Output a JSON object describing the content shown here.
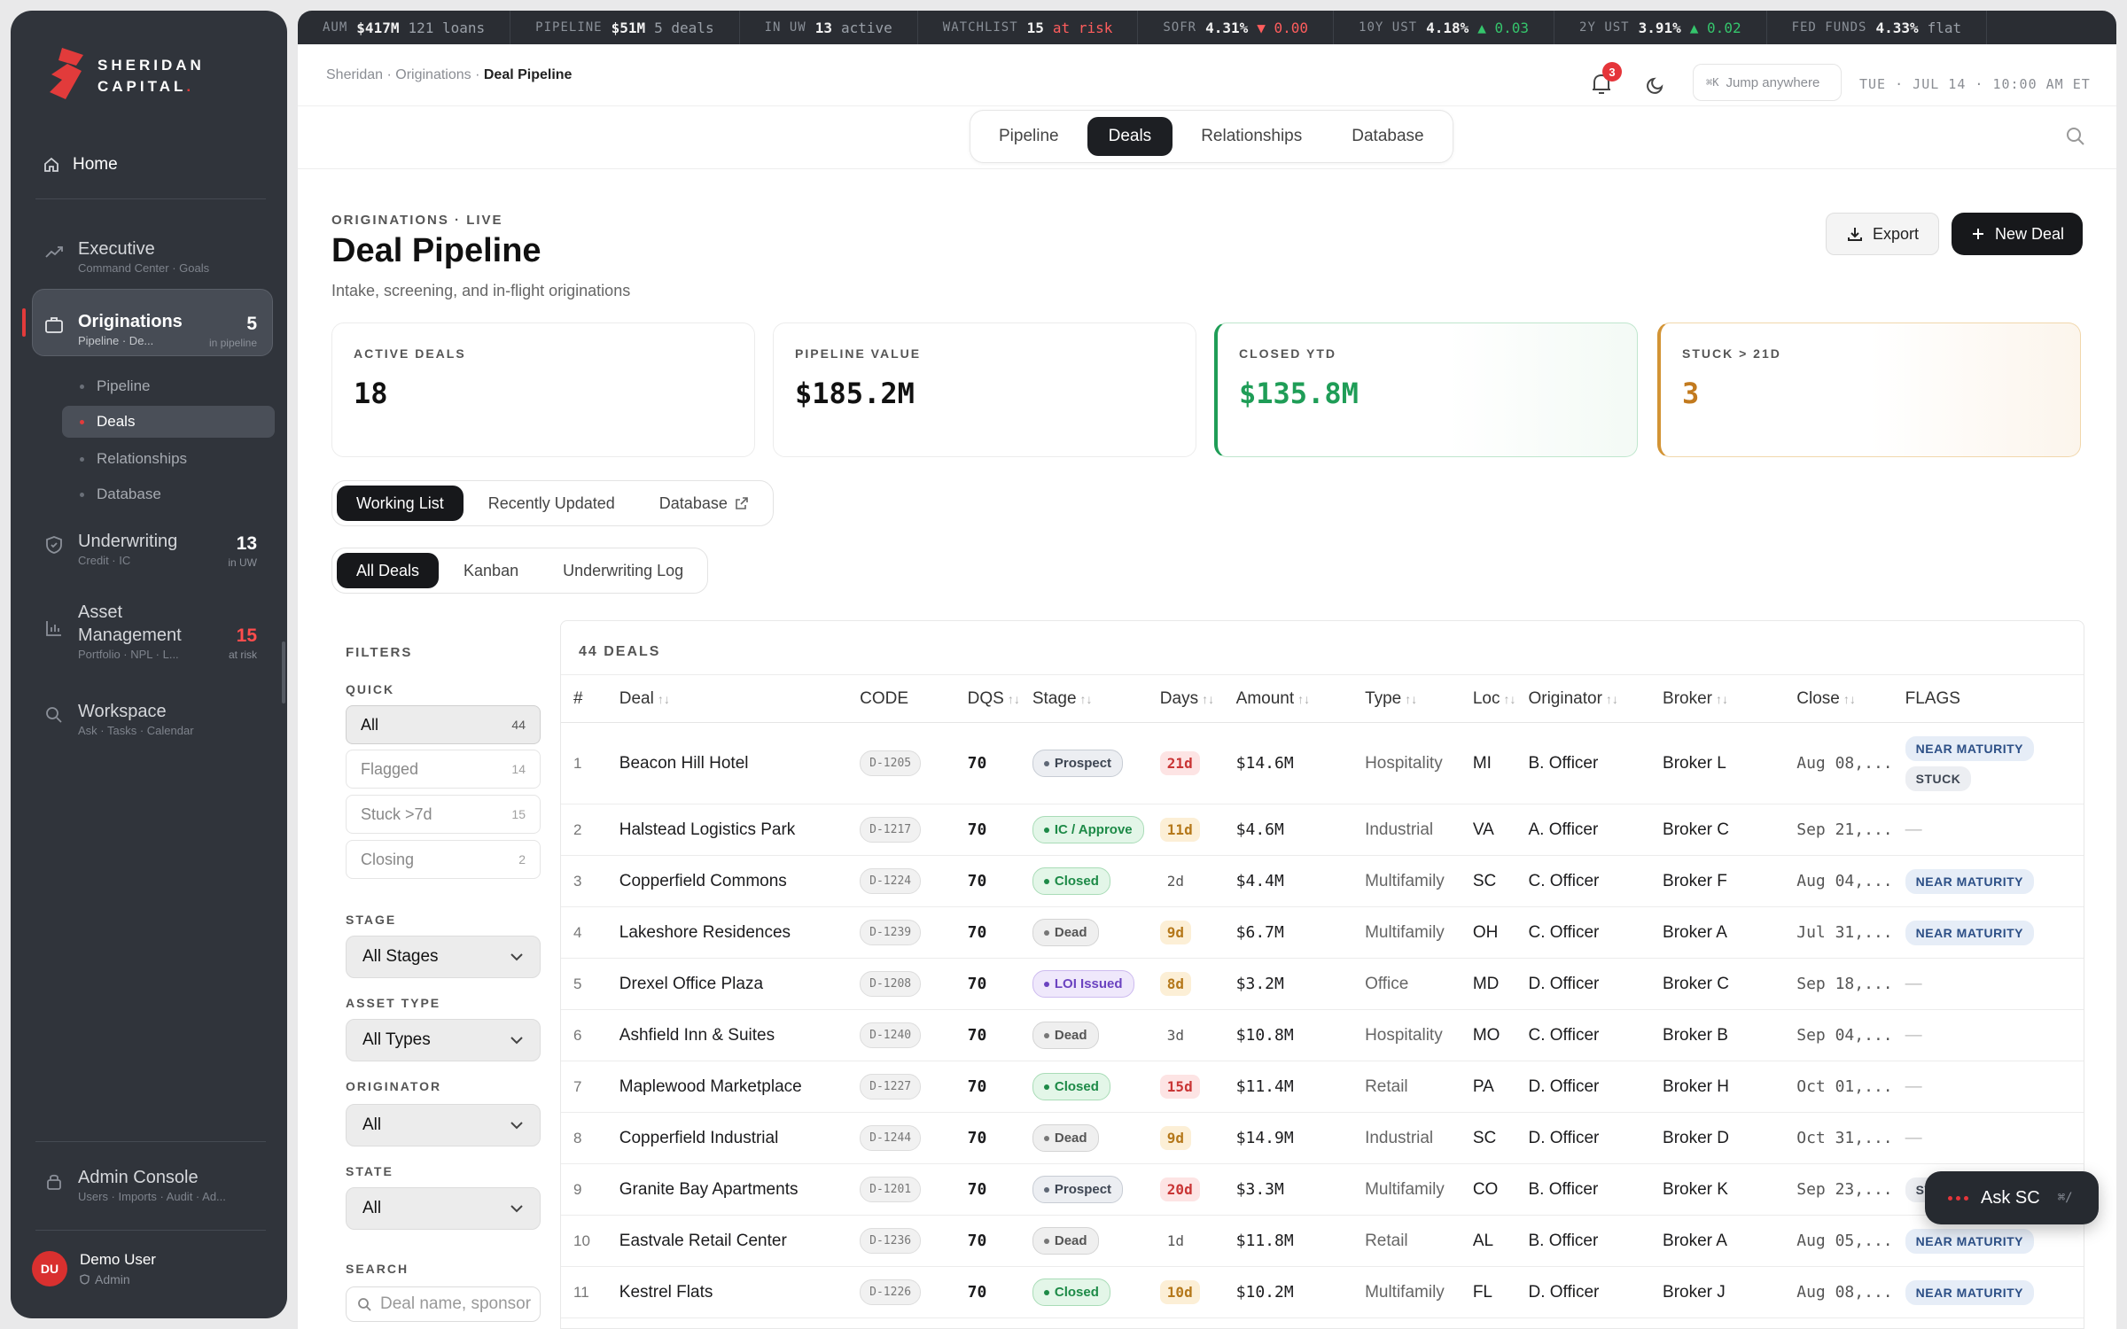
{
  "brand": {
    "line1": "SHERIDAN",
    "line2": "CAPITAL",
    "color": "#e23b3b"
  },
  "ticker": [
    {
      "key": "AUM",
      "value": "$417M",
      "extra": "121 loans",
      "extra_class": ""
    },
    {
      "key": "PIPELINE",
      "value": "$51M",
      "extra": "5 deals",
      "extra_class": ""
    },
    {
      "key": "IN UW",
      "value": "13",
      "extra": "active",
      "extra_class": ""
    },
    {
      "key": "WATCHLIST",
      "value": "15",
      "extra": "at risk",
      "extra_class": "dn"
    },
    {
      "key": "SOFR",
      "value": "4.31%",
      "extra": "▼ 0.00",
      "extra_class": "dn"
    },
    {
      "key": "10Y UST",
      "value": "4.18%",
      "extra": "▲ 0.03",
      "extra_class": "up"
    },
    {
      "key": "2Y UST",
      "value": "3.91%",
      "extra": "▲ 0.02",
      "extra_class": "up"
    },
    {
      "key": "FED FUNDS",
      "value": "4.33%",
      "extra": "flat",
      "extra_class": ""
    }
  ],
  "sidebar": {
    "home": "Home",
    "executive": {
      "label": "Executive",
      "sub": "Command Center · Goals"
    },
    "originations": {
      "label": "Originations",
      "sub": "Pipeline · De...",
      "count": "5",
      "count_sub": "in pipeline"
    },
    "sub_items": [
      "Pipeline",
      "Deals",
      "Relationships",
      "Database"
    ],
    "underwriting": {
      "label": "Underwriting",
      "sub": "Credit · IC",
      "count": "13",
      "count_sub": "in UW"
    },
    "asset": {
      "label1": "Asset",
      "label2": "Management",
      "sub": "Portfolio · NPL · L...",
      "count": "15",
      "count_sub": "at risk"
    },
    "workspace": {
      "label": "Workspace",
      "sub": "Ask · Tasks · Calendar"
    },
    "admin": {
      "label": "Admin Console",
      "sub": "Users · Imports · Audit · Ad..."
    },
    "user": {
      "initials": "DU",
      "name": "Demo User",
      "role": "Admin"
    }
  },
  "topbar": {
    "crumb1": "Sheridan",
    "crumb2": "Originations",
    "crumb3": "Deal Pipeline",
    "notif_count": "3",
    "jump": "Jump anywhere",
    "jump_kbd": "⌘K",
    "clock": "TUE · JUL 14 · 10:00 AM ET"
  },
  "tabs": [
    "Pipeline",
    "Deals",
    "Relationships",
    "Database"
  ],
  "header": {
    "eyebrow": "ORIGINATIONS · LIVE",
    "title": "Deal Pipeline",
    "subtitle": "Intake, screening, and in-flight originations",
    "export": "Export",
    "new_deal": "New Deal"
  },
  "kpis": [
    {
      "label": "ACTIVE DEALS",
      "value": "18"
    },
    {
      "label": "PIPELINE VALUE",
      "value": "$185.2M"
    },
    {
      "label": "CLOSED YTD",
      "value": "$135.8M"
    },
    {
      "label": "STUCK > 21D",
      "value": "3"
    }
  ],
  "views": [
    "Working List",
    "Recently Updated",
    "Database"
  ],
  "modes": [
    "All Deals",
    "Kanban",
    "Underwriting Log"
  ],
  "filters": {
    "title": "FILTERS",
    "quick_label": "QUICK",
    "quick": [
      {
        "label": "All",
        "count": "44"
      },
      {
        "label": "Flagged",
        "count": "14"
      },
      {
        "label": "Stuck >7d",
        "count": "15"
      },
      {
        "label": "Closing",
        "count": "2"
      }
    ],
    "stage_label": "STAGE",
    "stage_value": "All Stages",
    "asset_label": "ASSET TYPE",
    "asset_value": "All Types",
    "orig_label": "ORIGINATOR",
    "orig_value": "All",
    "state_label": "STATE",
    "state_value": "All",
    "search_label": "SEARCH",
    "search_placeholder": "Deal name, sponsor"
  },
  "table": {
    "count": "44 DEALS",
    "headers": [
      "#",
      "Deal",
      "CODE",
      "DQS",
      "Stage",
      "Days",
      "Amount",
      "Type",
      "Loc",
      "Originator",
      "Broker",
      "Close",
      "FLAGS"
    ],
    "rows": [
      {
        "n": "1",
        "deal": "Beacon Hill Hotel",
        "code": "D-1205",
        "dqs": "70",
        "stage": "Prospect",
        "stage_class": "s-prospect",
        "days": "21d",
        "days_class": "d-red",
        "amount": "$14.6M",
        "type": "Hospitality",
        "loc": "MI",
        "orig": "B. Officer",
        "broker": "Broker L",
        "close": "Aug 08,...",
        "flags": [
          "NEAR MATURITY",
          "STUCK"
        ]
      },
      {
        "n": "2",
        "deal": "Halstead Logistics Park",
        "code": "D-1217",
        "dqs": "70",
        "stage": "IC / Approve",
        "stage_class": "s-ic",
        "days": "11d",
        "days_class": "d-amb",
        "amount": "$4.6M",
        "type": "Industrial",
        "loc": "VA",
        "orig": "A. Officer",
        "broker": "Broker C",
        "close": "Sep 21,...",
        "flags": []
      },
      {
        "n": "3",
        "deal": "Copperfield Commons",
        "code": "D-1224",
        "dqs": "70",
        "stage": "Closed",
        "stage_class": "s-closed",
        "days": "2d",
        "days_class": "d-plain",
        "amount": "$4.4M",
        "type": "Multifamily",
        "loc": "SC",
        "orig": "C. Officer",
        "broker": "Broker F",
        "close": "Aug 04,...",
        "flags": [
          "NEAR MATURITY"
        ]
      },
      {
        "n": "4",
        "deal": "Lakeshore Residences",
        "code": "D-1239",
        "dqs": "70",
        "stage": "Dead",
        "stage_class": "s-dead",
        "days": "9d",
        "days_class": "d-amb",
        "amount": "$6.7M",
        "type": "Multifamily",
        "loc": "OH",
        "orig": "C. Officer",
        "broker": "Broker A",
        "close": "Jul 31,...",
        "flags": [
          "NEAR MATURITY"
        ]
      },
      {
        "n": "5",
        "deal": "Drexel Office Plaza",
        "code": "D-1208",
        "dqs": "70",
        "stage": "LOI Issued",
        "stage_class": "s-loi",
        "days": "8d",
        "days_class": "d-amb",
        "amount": "$3.2M",
        "type": "Office",
        "loc": "MD",
        "orig": "D. Officer",
        "broker": "Broker C",
        "close": "Sep 18,...",
        "flags": []
      },
      {
        "n": "6",
        "deal": "Ashfield Inn & Suites",
        "code": "D-1240",
        "dqs": "70",
        "stage": "Dead",
        "stage_class": "s-dead",
        "days": "3d",
        "days_class": "d-plain",
        "amount": "$10.8M",
        "type": "Hospitality",
        "loc": "MO",
        "orig": "C. Officer",
        "broker": "Broker B",
        "close": "Sep 04,...",
        "flags": []
      },
      {
        "n": "7",
        "deal": "Maplewood Marketplace",
        "code": "D-1227",
        "dqs": "70",
        "stage": "Closed",
        "stage_class": "s-closed",
        "days": "15d",
        "days_class": "d-red",
        "amount": "$11.4M",
        "type": "Retail",
        "loc": "PA",
        "orig": "D. Officer",
        "broker": "Broker H",
        "close": "Oct 01,...",
        "flags": []
      },
      {
        "n": "8",
        "deal": "Copperfield Industrial",
        "code": "D-1244",
        "dqs": "70",
        "stage": "Dead",
        "stage_class": "s-dead",
        "days": "9d",
        "days_class": "d-amb",
        "amount": "$14.9M",
        "type": "Industrial",
        "loc": "SC",
        "orig": "D. Officer",
        "broker": "Broker D",
        "close": "Oct 31,...",
        "flags": []
      },
      {
        "n": "9",
        "deal": "Granite Bay Apartments",
        "code": "D-1201",
        "dqs": "70",
        "stage": "Prospect",
        "stage_class": "s-prospect",
        "days": "20d",
        "days_class": "d-red",
        "amount": "$3.3M",
        "type": "Multifamily",
        "loc": "CO",
        "orig": "B. Officer",
        "broker": "Broker K",
        "close": "Sep 23,...",
        "flags": [
          "STUCK"
        ]
      },
      {
        "n": "10",
        "deal": "Eastvale Retail Center",
        "code": "D-1236",
        "dqs": "70",
        "stage": "Dead",
        "stage_class": "s-dead",
        "days": "1d",
        "days_class": "d-plain",
        "amount": "$11.8M",
        "type": "Retail",
        "loc": "AL",
        "orig": "B. Officer",
        "broker": "Broker A",
        "close": "Aug 05,...",
        "flags": [
          "NEAR MATURITY"
        ]
      },
      {
        "n": "11",
        "deal": "Kestrel Flats",
        "code": "D-1226",
        "dqs": "70",
        "stage": "Closed",
        "stage_class": "s-closed",
        "days": "10d",
        "days_class": "d-amb",
        "amount": "$10.2M",
        "type": "Multifamily",
        "loc": "FL",
        "orig": "D. Officer",
        "broker": "Broker J",
        "close": "Aug 08,...",
        "flags": [
          "NEAR MATURITY"
        ]
      }
    ]
  },
  "ask": {
    "label": "Ask SC",
    "kbd": "⌘/"
  }
}
